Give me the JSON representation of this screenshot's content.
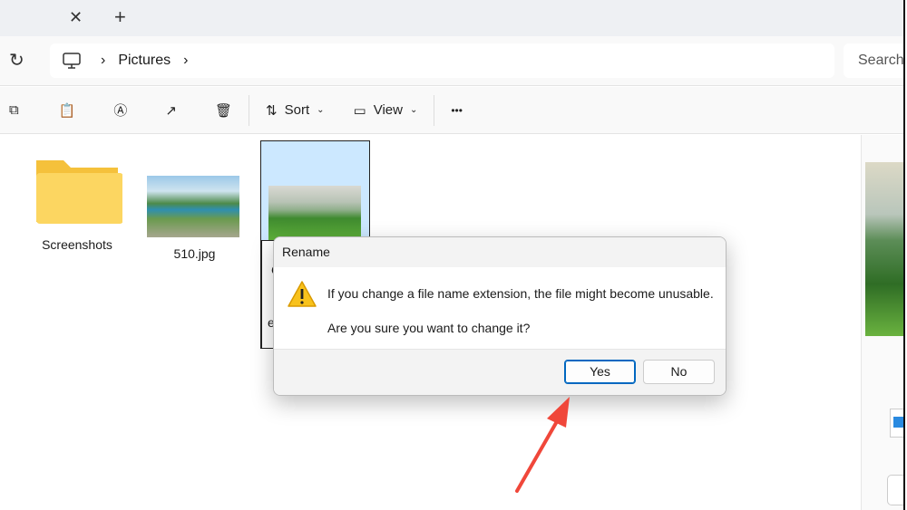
{
  "tabbar": {
    "close": "✕",
    "new_tab": "+"
  },
  "address": {
    "location": "Pictures",
    "search_placeholder": "Search"
  },
  "toolbar": {
    "sort": "Sort",
    "view": "View",
    "more": "•••"
  },
  "files": [
    {
      "name": "Screenshots",
      "type": "folder"
    },
    {
      "name": "510.jpg",
      "type": "image"
    },
    {
      "name_partial_1": "C",
      "name_partial_2": "e",
      "type": "image",
      "selected": true
    }
  ],
  "dialog": {
    "title": "Rename",
    "message": "If you change a file name extension, the file might become unusable.",
    "question": "Are you sure you want to change it?",
    "yes": "Yes",
    "no": "No"
  },
  "colors": {
    "accent": "#0067c0",
    "selection": "#cce8ff",
    "annotation": "#f0473a"
  }
}
